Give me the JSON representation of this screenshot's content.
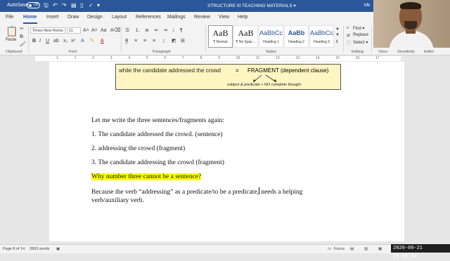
{
  "title_bar": {
    "autosave_label": "AutoSave",
    "autosave_state": "Off",
    "doc_title": "STRUCTURE III TEACHING MATERIALS ▾",
    "user_initials": "kfk"
  },
  "tabs": [
    "File",
    "Home",
    "Insert",
    "Draw",
    "Design",
    "Layout",
    "References",
    "Mailings",
    "Review",
    "View",
    "Help"
  ],
  "active_tab": "Home",
  "ribbon": {
    "paste_label": "Paste",
    "clipboard_label": "Clipboard",
    "font_name": "Times New Roma",
    "font_size": "11",
    "font_label": "Font",
    "paragraph_label": "Paragraph",
    "styles_label": "Styles",
    "styles": [
      {
        "sample": "AaB",
        "name": "¶ Normal"
      },
      {
        "sample": "AaB",
        "name": "¶ No Spac..."
      },
      {
        "sample": "AaBbCc",
        "name": "Heading 1"
      },
      {
        "sample": "AaBb",
        "name": "Heading 2"
      },
      {
        "sample": "AaBbCcD",
        "name": "Heading 3"
      }
    ],
    "find_label": "Find ▾",
    "replace_label": "Replace",
    "select_label": "Select ▾",
    "editing_label": "Editing",
    "voice_label": "Voice",
    "sensitivity_label": "Sensitivity",
    "editor_label": "Editor"
  },
  "callout": {
    "phrase": "while the candidate addressed the crowd",
    "equals": "=",
    "fragment": "FRAGMENT  (dependent clause)",
    "subtext": "subject & predicate  +   NO complete thought"
  },
  "paragraphs": {
    "p1": "Let me write the three sentences/fragments again:",
    "p2": "1. The candidate addressed the crowd. (sentence)",
    "p3": "2. addressing the crowd (fragment)",
    "p4": "3. The candidate addressing the crowd (fragment)",
    "p5": "Why number three cannot be a sentence?",
    "p6a": "Because the verb “addressing” as a predicate/to be a predicate,",
    "p6b": " needs a helping",
    "p7": "verb/auxiliary verb."
  },
  "status_bar": {
    "page": "Page 8 of 14",
    "words": "2863 words",
    "focus": "Focus"
  },
  "timestamp": "2020-09-21 09:08:34",
  "colors": {
    "brand": "#2b579a",
    "highlight": "#ffff00",
    "callout_bg": "#fdf6c3"
  }
}
